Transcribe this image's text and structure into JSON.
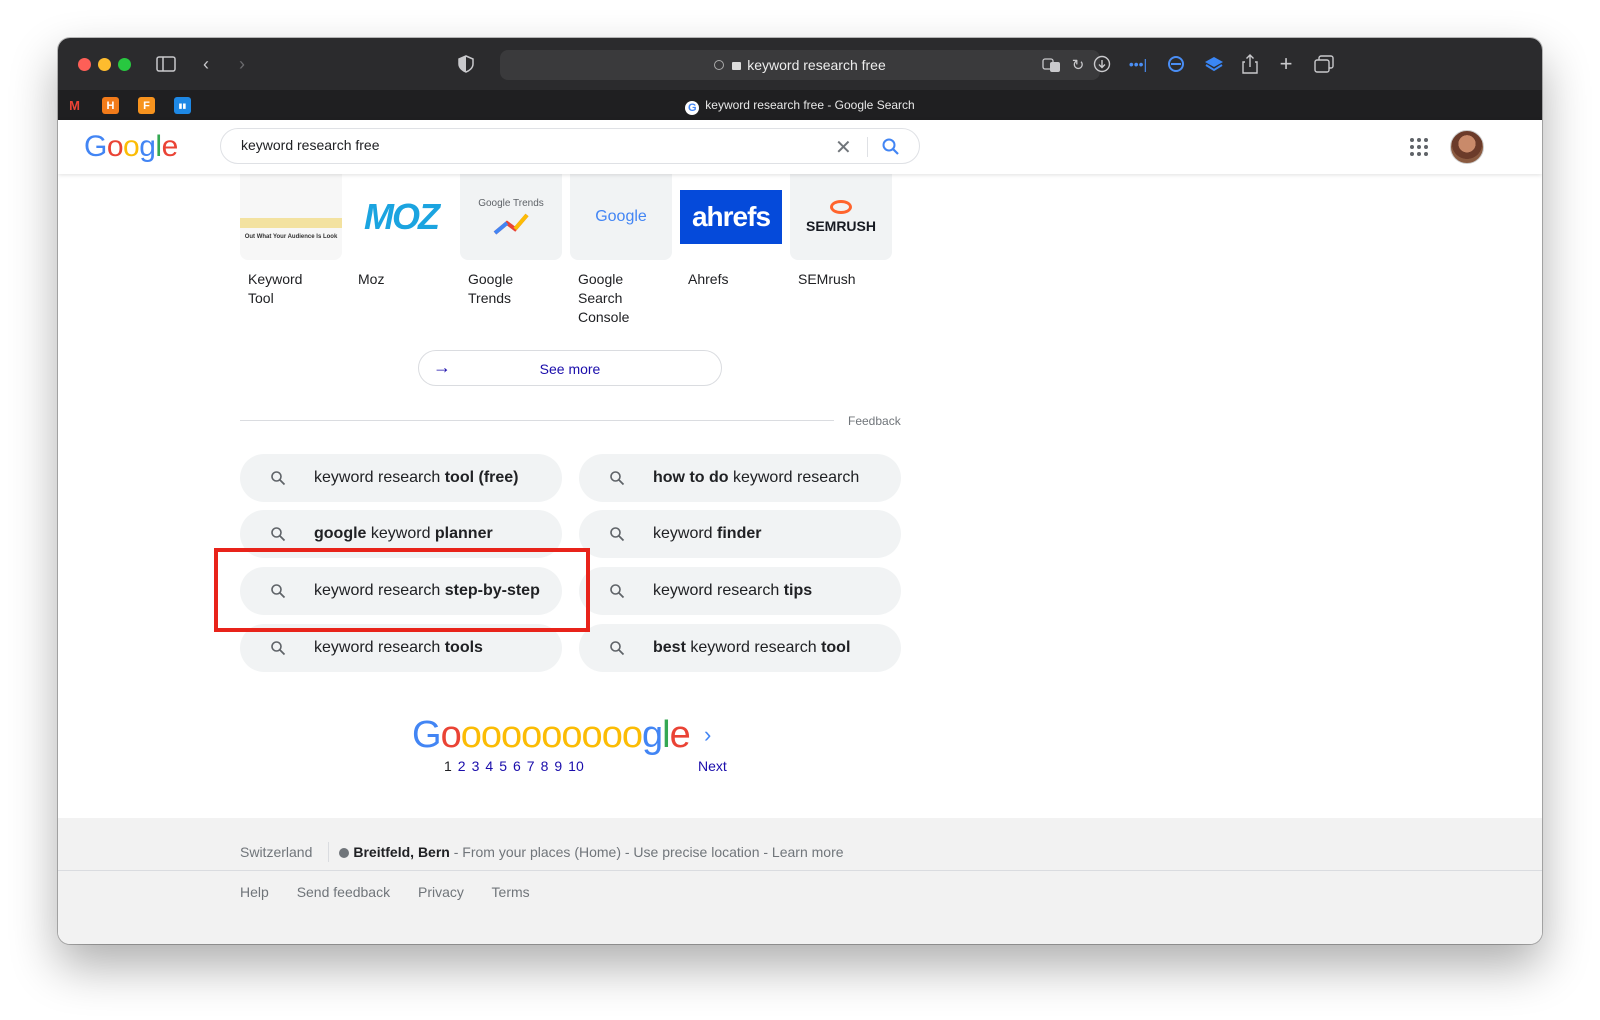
{
  "browser": {
    "address": "keyword research free",
    "tab_title": "keyword research free - Google Search",
    "favicons": [
      {
        "name": "gmail-icon",
        "glyph": "M",
        "color": "#ea4335"
      },
      {
        "name": "h-app-icon",
        "glyph": "H",
        "color": "#f27b1a"
      },
      {
        "name": "f-app-icon",
        "glyph": "F",
        "color": "#f7931e"
      },
      {
        "name": "trello-icon",
        "glyph": "▮▮",
        "color": "#1e88e5"
      }
    ]
  },
  "google": {
    "logo": [
      "G",
      "o",
      "o",
      "g",
      "l",
      "e"
    ],
    "logo_colors": [
      "#4285f4",
      "#ea4335",
      "#fbbc05",
      "#4285f4",
      "#34a853",
      "#ea4335"
    ],
    "query": "keyword research free"
  },
  "tools": [
    {
      "label": "Keyword\nTool",
      "thumb_text": "Out What Your Audience Is Look"
    },
    {
      "label": "Moz",
      "thumb_text": "MOZ"
    },
    {
      "label": "Google\nTrends",
      "thumb_text": "Google Trends"
    },
    {
      "label": "Google\nSearch\nConsole",
      "thumb_text": "Google"
    },
    {
      "label": "Ahrefs",
      "thumb_text": "ahrefs"
    },
    {
      "label": "SEMrush",
      "thumb_text": "SEMRUSH"
    }
  ],
  "see_more": "See more",
  "feedback": "Feedback",
  "related_searches": [
    {
      "parts": [
        {
          "t": "keyword research ",
          "b": false
        },
        {
          "t": "tool (free)",
          "b": true
        }
      ]
    },
    {
      "parts": [
        {
          "t": "how to do",
          "b": true
        },
        {
          "t": " keyword research",
          "b": false
        }
      ]
    },
    {
      "parts": [
        {
          "t": "google",
          "b": true
        },
        {
          "t": " keyword ",
          "b": false
        },
        {
          "t": "planner",
          "b": true
        }
      ]
    },
    {
      "parts": [
        {
          "t": "keyword ",
          "b": false
        },
        {
          "t": "finder",
          "b": true
        }
      ]
    },
    {
      "parts": [
        {
          "t": "keyword research ",
          "b": false
        },
        {
          "t": "step-by-step",
          "b": true
        }
      ]
    },
    {
      "parts": [
        {
          "t": "keyword research ",
          "b": false
        },
        {
          "t": "tips",
          "b": true
        }
      ]
    },
    {
      "parts": [
        {
          "t": "keyword research ",
          "b": false
        },
        {
          "t": "tools",
          "b": true
        }
      ]
    },
    {
      "parts": [
        {
          "t": "best",
          "b": true
        },
        {
          "t": " keyword research ",
          "b": false
        },
        {
          "t": "tool",
          "b": true
        }
      ]
    }
  ],
  "pagination": {
    "goooogle": [
      "G",
      "o",
      "o",
      "o",
      "o",
      "o",
      "o",
      "o",
      "o",
      "o",
      "o",
      "g",
      "l",
      "e"
    ],
    "goooogle_colors": [
      "#4285f4",
      "#ea4335",
      "#fbbc05",
      "#fbbc05",
      "#fbbc05",
      "#fbbc05",
      "#fbbc05",
      "#fbbc05",
      "#fbbc05",
      "#fbbc05",
      "#fbbc05",
      "#4285f4",
      "#34a853",
      "#ea4335"
    ],
    "pages": [
      "1",
      "2",
      "3",
      "4",
      "5",
      "6",
      "7",
      "8",
      "9",
      "10"
    ],
    "current": "1",
    "next": "Next"
  },
  "footer": {
    "country": "Switzerland",
    "location": "Breitfeld, Bern",
    "location_rest": " - From your places (Home) - Use precise location - Learn more",
    "links": [
      "Help",
      "Send feedback",
      "Privacy",
      "Terms"
    ]
  }
}
